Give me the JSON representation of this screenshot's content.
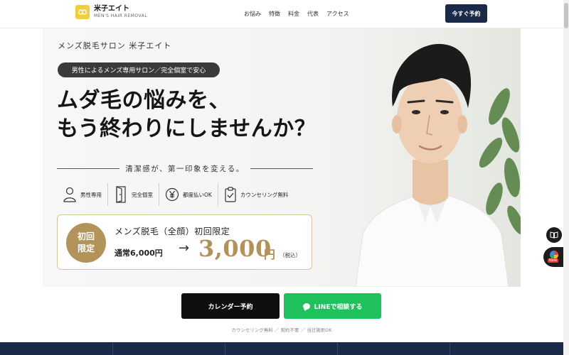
{
  "header": {
    "logo_name": "米子エイト",
    "logo_sub": "MEN'S HAIR REMOVAL",
    "nav": [
      "お悩み",
      "特徴",
      "料金",
      "代表",
      "アクセス"
    ],
    "cta_label": "今すぐ予約"
  },
  "hero": {
    "salon_name": "メンズ脱毛サロン 米子エイト",
    "pill": "男性によるメンズ専用サロン／完全個室で安心",
    "headline_line1": "ムダ毛の悩みを、",
    "headline_line2": "もう終わりにしませんか？",
    "tagline": "清潔感が、第一印象を変える。",
    "features": [
      {
        "icon": "person-icon",
        "label": "男性専用"
      },
      {
        "icon": "door-icon",
        "label": "完全個室"
      },
      {
        "icon": "yen-icon",
        "label": "都度払いOK"
      },
      {
        "icon": "clipboard-icon",
        "label": "カウンセリング無料"
      }
    ],
    "offer": {
      "badge_line1": "初回",
      "badge_line2": "限定",
      "title": "メンズ脱毛（全顔）初回限定",
      "normal_price": "通常6,000円",
      "arrow": "→",
      "price": "3,000",
      "yen": "円",
      "tax": "（税込）"
    }
  },
  "cta": {
    "calendar_label": "カレンダー予約",
    "line_label": "LINEで相談する",
    "note": "カウンセリング無料 ／ 契約不要 ／ 当日施術OK"
  },
  "side": {
    "new_label": "New"
  },
  "colors": {
    "navy": "#1c2a4a",
    "gold": "#b39257",
    "line_green": "#1fc15d",
    "logo_yellow": "#f2cf3a"
  }
}
